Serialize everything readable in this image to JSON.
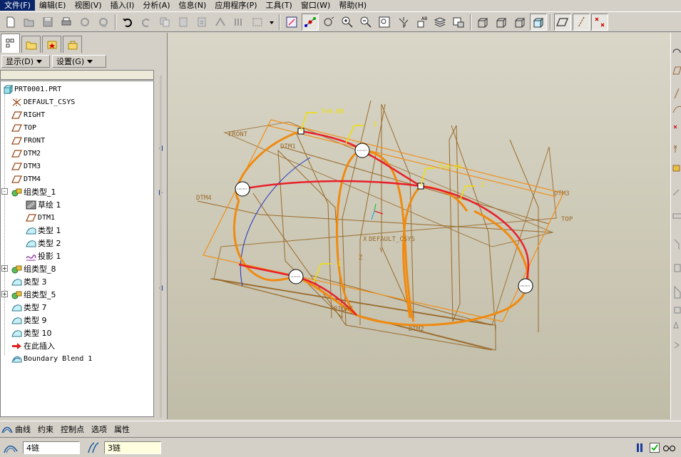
{
  "menu": {
    "items": [
      "文件(F)",
      "编辑(E)",
      "视图(V)",
      "插入(I)",
      "分析(A)",
      "信息(N)",
      "应用程序(P)",
      "工具(T)",
      "窗口(W)",
      "帮助(H)"
    ]
  },
  "toolbar": {
    "icons": [
      "new-file-icon",
      "open-file-icon",
      "save-icon",
      "print-icon",
      "send-mail-icon",
      "mail-recipient-icon",
      "undo-icon",
      "redo-icon",
      "copy-icon",
      "paste-icon",
      "paste-special-icon",
      "regenerate-icon",
      "find-icon",
      "select-box-icon",
      "dropdown-icon",
      "sketch-view-icon",
      "spin-center-icon",
      "orient-icon",
      "zoom-in-icon",
      "zoom-out-icon",
      "refit-icon",
      "repaint-icon",
      "view-manager-icon",
      "layers-icon",
      "saved-views-icon",
      "wireframe-icon",
      "hidden-line-icon",
      "no-hidden-icon",
      "shading-icon",
      "datum-plane-display-icon",
      "datum-axis-display-icon",
      "datum-point-display-icon"
    ]
  },
  "panel": {
    "display_label": "显示(D)",
    "settings_label": "设置(G)"
  },
  "tree": {
    "items": [
      {
        "label": "PRT0001.PRT",
        "icon": "part-icon",
        "indent": 0
      },
      {
        "label": "DEFAULT_CSYS",
        "icon": "csys-icon",
        "indent": 1
      },
      {
        "label": "RIGHT",
        "icon": "datum-plane-icon",
        "indent": 1
      },
      {
        "label": "TOP",
        "icon": "datum-plane-icon",
        "indent": 1
      },
      {
        "label": "FRONT",
        "icon": "datum-plane-icon",
        "indent": 1
      },
      {
        "label": "DTM2",
        "icon": "datum-plane-icon",
        "indent": 1
      },
      {
        "label": "DTM3",
        "icon": "datum-plane-icon",
        "indent": 1
      },
      {
        "label": "DTM4",
        "icon": "datum-plane-icon",
        "indent": 1
      },
      {
        "label": "组类型_1",
        "icon": "group-icon",
        "indent": 1,
        "expander": "-"
      },
      {
        "label": "草绘 1",
        "icon": "sketch-icon",
        "indent": 2
      },
      {
        "label": "DTM1",
        "icon": "datum-plane-icon",
        "indent": 2
      },
      {
        "label": "类型 1",
        "icon": "surface-icon",
        "indent": 2
      },
      {
        "label": "类型 2",
        "icon": "surface-icon",
        "indent": 2
      },
      {
        "label": "投影 1",
        "icon": "projection-icon",
        "indent": 2
      },
      {
        "label": "组类型_8",
        "icon": "group-icon",
        "indent": 1,
        "expander": "+"
      },
      {
        "label": "类型 3",
        "icon": "surface-icon",
        "indent": 1
      },
      {
        "label": "组类型_5",
        "icon": "group-icon",
        "indent": 1,
        "expander": "+"
      },
      {
        "label": "类型 7",
        "icon": "surface-icon",
        "indent": 1
      },
      {
        "label": "类型 9",
        "icon": "surface-icon",
        "indent": 1
      },
      {
        "label": "类型 10",
        "icon": "surface-icon",
        "indent": 1
      },
      {
        "label": "在此插入",
        "icon": "insert-here-arrow-icon",
        "indent": 1
      },
      {
        "label": "Boundary Blend 1",
        "icon": "boundary-blend-icon",
        "indent": 1
      }
    ]
  },
  "viewport": {
    "datum_labels": [
      "FRONT",
      "DTM1",
      "DTM4",
      "DTM3",
      "TOP",
      "RIGHT",
      "DTM2",
      "DEFAULT_CSYS",
      "X",
      "Y",
      "Z"
    ],
    "tangency_labels": [
      "T=0.00",
      "T=0.00"
    ],
    "chain_numbers": [
      "3",
      "2",
      "1"
    ],
    "colors": {
      "curve_red": "#e8202a",
      "curve_orange": "#f08a10",
      "datum_brown": "#9a6a2a",
      "datum_orange": "#f0901a",
      "blue_curve": "#2030c0",
      "label_yellow": "#f0e000"
    }
  },
  "dashboard": {
    "tabs": [
      "曲线",
      "约束",
      "控制点",
      "选项",
      "属性"
    ]
  },
  "status": {
    "first_direction": "4链",
    "second_direction": "3链"
  }
}
